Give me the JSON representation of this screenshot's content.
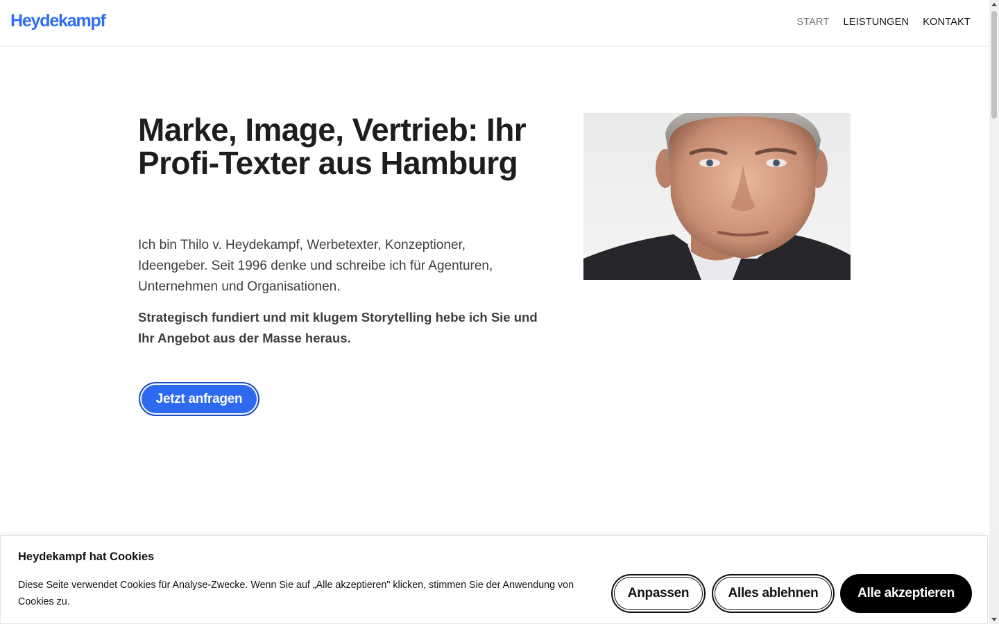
{
  "header": {
    "logo": "Heydekampf",
    "nav": [
      {
        "label": "START",
        "active": true
      },
      {
        "label": "LEISTUNGEN",
        "active": false
      },
      {
        "label": "KONTAKT",
        "active": false
      }
    ]
  },
  "hero": {
    "title": "Marke, Image, Vertrieb: Ihr Profi-Texter aus Hamburg",
    "intro": "Ich bin Thilo v. Heydekampf, Werbetexter, Konzeptioner, Ideengeber. Seit 1996 denke und schreibe ich für Agenturen, Unternehmen und Organisationen.",
    "strong": "Strategisch fundiert und mit klugem Storytelling hebe ich Sie und Ihr Angebot aus der Masse heraus.",
    "cta_label": "Jetzt anfragen"
  },
  "cookie": {
    "title": "Heydekampf hat Cookies",
    "text": "Diese Seite verwendet Cookies für Analyse-Zwecke. Wenn Sie auf „Alle akzeptieren\" klicken, stimmen Sie der Anwendung von Cookies zu.",
    "customize_label": "Anpassen",
    "reject_label": "Alles ablehnen",
    "accept_label": "Alle akzeptieren"
  },
  "colors": {
    "brand": "#2f6df2",
    "cta": "#2e6af0",
    "accept_button": "#000000"
  }
}
